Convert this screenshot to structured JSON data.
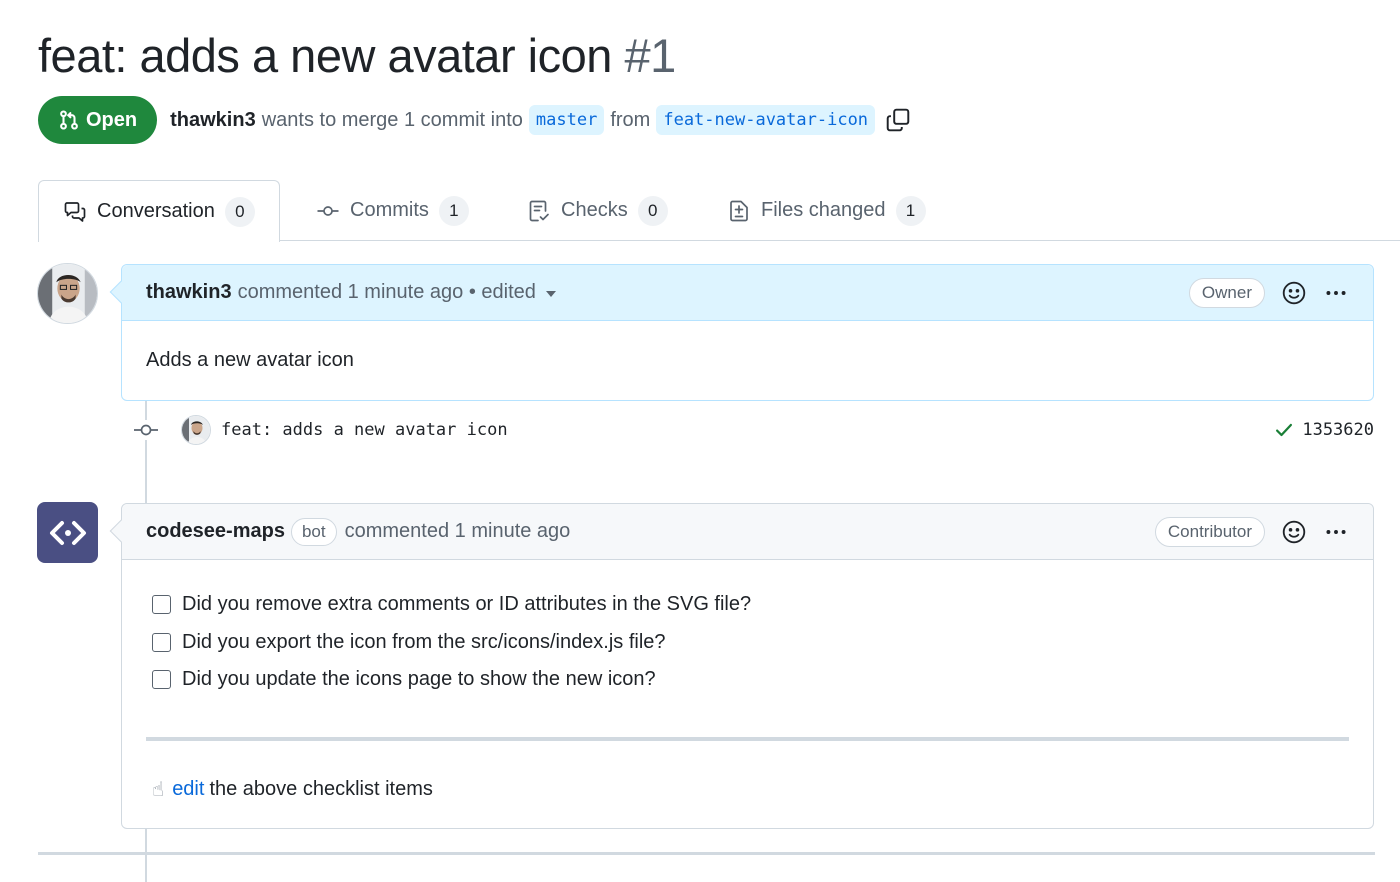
{
  "header": {
    "title": "feat: adds a new avatar icon",
    "number": "#1",
    "state": "Open",
    "author": "thawkin3",
    "merge_text": "wants to merge 1 commit into",
    "base_branch": "master",
    "from_text": "from",
    "head_branch": "feat-new-avatar-icon",
    "copy_icon": "copy-icon"
  },
  "tabs": [
    {
      "label": "Conversation",
      "count": "0",
      "icon": "comment-discussion-icon"
    },
    {
      "label": "Commits",
      "count": "1",
      "icon": "git-commit-icon"
    },
    {
      "label": "Checks",
      "count": "0",
      "icon": "checklist-icon"
    },
    {
      "label": "Files changed",
      "count": "1",
      "icon": "file-diff-icon"
    }
  ],
  "comments": [
    {
      "author": "thawkin3",
      "action": "commented 1 minute ago • edited",
      "role": "Owner",
      "body": "Adds a new avatar icon"
    },
    {
      "author": "codesee-maps",
      "bot_label": "bot",
      "action": "commented 1 minute ago",
      "role": "Contributor",
      "checklist": [
        "Did you remove extra comments or ID attributes in the SVG file?",
        "Did you export the icon from the src/icons/index.js file?",
        "Did you update the icons page to show the new icon?"
      ],
      "footer_link": "edit",
      "footer_text": "the above checklist items"
    }
  ],
  "commit": {
    "message": "feat: adds a new avatar icon",
    "sha": "1353620",
    "status": "success"
  },
  "colors": {
    "open_green": "#1f883d",
    "accent_blue": "#0969da",
    "owner_header_bg": "#ddf4ff",
    "bot_avatar_bg": "#4a4f83"
  }
}
